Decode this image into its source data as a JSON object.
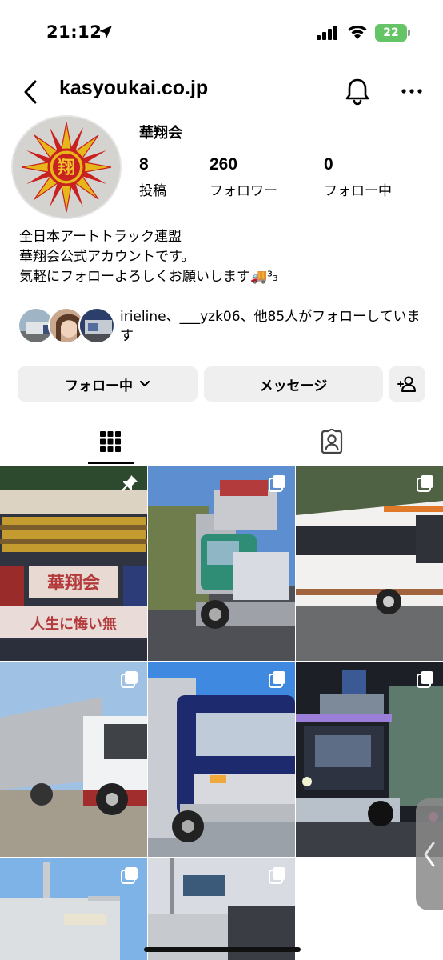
{
  "status_bar": {
    "time": "21:12",
    "battery": "22"
  },
  "header": {
    "username": "kasyoukai.co.jp"
  },
  "profile": {
    "display_name": "華翔会",
    "avatar_glyph": "翔",
    "stats": [
      {
        "value": "8",
        "label": "投稿"
      },
      {
        "value": "260",
        "label": "フォロワー"
      },
      {
        "value": "0",
        "label": "フォロー中"
      }
    ],
    "bio": [
      "全日本アートトラック連盟",
      "華翔会公式アカウントです。",
      "気軽にフォローよろしくお願いします🚚³₃"
    ],
    "mutual_text": "irieline、___yzk06、他85人がフォローしています"
  },
  "actions": {
    "following_label": "フォロー中",
    "message_label": "メッセージ"
  },
  "posts": [
    {
      "kind": "pinned",
      "sign1": "華翔会",
      "sign2": "人生に悔い無"
    },
    {
      "kind": "multi"
    },
    {
      "kind": "multi"
    },
    {
      "kind": "multi"
    },
    {
      "kind": "multi"
    },
    {
      "kind": "multi"
    },
    {
      "kind": "multi"
    },
    {
      "kind": "multi"
    }
  ],
  "colors": {
    "accent": "#000000",
    "button_bg": "#efefef",
    "battery": "#65c466"
  }
}
